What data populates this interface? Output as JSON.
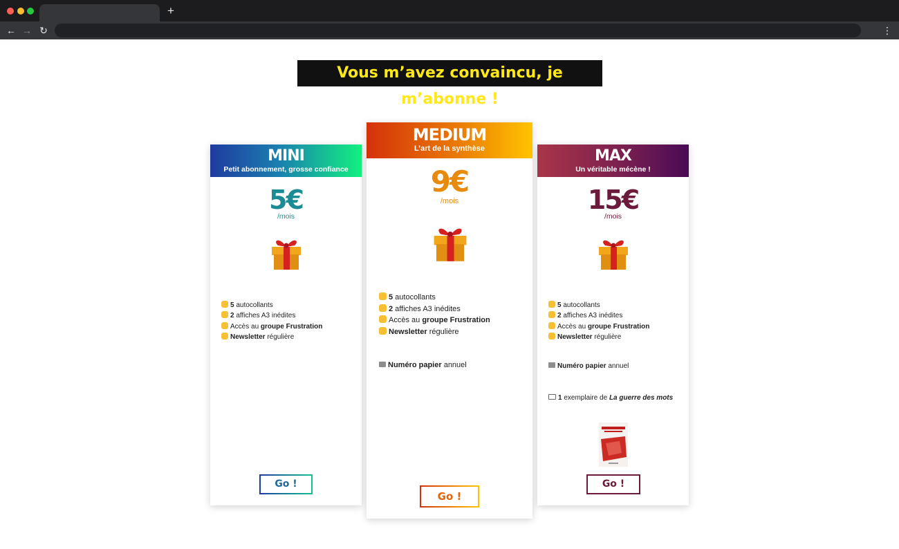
{
  "headline": "Vous m’avez convaincu, je m’abonne !",
  "plans": {
    "mini": {
      "name": "MINI",
      "tagline": "Petit abonnement, grosse confiance",
      "price": "5€",
      "period": "/mois",
      "features": [
        {
          "bold": "5",
          "text": " autocollants"
        },
        {
          "bold": "2",
          "text": " affiches A3 inédites"
        },
        {
          "text": "Accès au ",
          "bold": "groupe Frustration"
        },
        {
          "bold": "Newsletter",
          "text": " régulière"
        }
      ],
      "cta": "Go !"
    },
    "medium": {
      "name": "MEDIUM",
      "tagline": "L’art de la synthèse",
      "price": "9€",
      "period": "/mois",
      "features": [
        {
          "bold": "5",
          "text": " autocollants"
        },
        {
          "bold": "2",
          "text": " affiches A3 inédites"
        },
        {
          "text": "Accès au ",
          "bold": "groupe Frustration"
        },
        {
          "bold": "Newsletter",
          "text": " régulière"
        }
      ],
      "extra_paper": {
        "bold": "Numéro papier",
        "text": " annuel"
      },
      "cta": "Go !"
    },
    "max": {
      "name": "MAX",
      "tagline": "Un véritable mécène !",
      "price": "15€",
      "period": "/mois",
      "features": [
        {
          "bold": "5",
          "text": " autocollants"
        },
        {
          "bold": "2",
          "text": " affiches A3 inédites"
        },
        {
          "text": "Accès au ",
          "bold": "groupe Frustration"
        },
        {
          "bold": "Newsletter",
          "text": " régulière"
        }
      ],
      "extra_paper": {
        "bold": "Numéro papier",
        "text": " annuel"
      },
      "extra_book": {
        "bold": "1",
        "text": " exemplaire de ",
        "italic": "La guerre des mots"
      },
      "cta": "Go !"
    }
  },
  "colors": {
    "headline_bg": "#111111",
    "headline_text": "#ffe81a",
    "mini_accent": "#1c8c94",
    "medium_accent": "#e78a0d",
    "max_accent": "#6b1a3c"
  },
  "icons": [
    "gift-icon",
    "fist-emoji-icon",
    "newspaper-icon",
    "open-book-icon"
  ]
}
